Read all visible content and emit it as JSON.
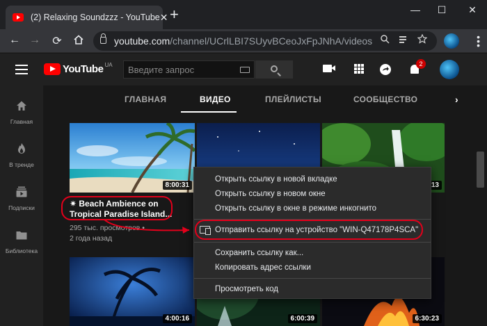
{
  "browser": {
    "tab_title": "(2) Relaxing Soundzzz - YouTube",
    "tab_close": "✕",
    "new_tab": "+",
    "url_host": "youtube.com",
    "url_path": "/channel/UCrlLBI7SUyvBCeoJxFpJNhA/videos",
    "window_minimize": "—",
    "window_maximize": "☐",
    "window_close": "✕",
    "back": "←",
    "forward": "→",
    "reload": "⟳"
  },
  "youtube": {
    "logo_text": "YouTube",
    "country_code": "UA",
    "search_placeholder": "Введите запрос",
    "notifications_count": "2"
  },
  "sidebar": {
    "items": [
      {
        "label": "Главная",
        "icon": "home-icon"
      },
      {
        "label": "В тренде",
        "icon": "trending-icon"
      },
      {
        "label": "Подписки",
        "icon": "subscriptions-icon"
      },
      {
        "label": "Библиотека",
        "icon": "library-icon"
      }
    ]
  },
  "channel_tabs": [
    {
      "label": "ГЛАВНАЯ"
    },
    {
      "label": "ВИДЕО"
    },
    {
      "label": "ПЛЕЙЛИСТЫ"
    },
    {
      "label": "СООБЩЕСТВО"
    }
  ],
  "videos": {
    "first": {
      "title": "✷ Beach Ambience on Tropical Paradise Island...",
      "views": "295 тыс. просмотров •",
      "age": "2 года назад",
      "duration": "8:00:31"
    },
    "durations": [
      "8:00:31",
      "13",
      "4:00:16",
      "6:00:39",
      "6:30:23"
    ]
  },
  "context_menu": {
    "items": [
      "Открыть ссылку в новой вкладке",
      "Открыть ссылку в новом окне",
      "Открыть ссылку в окне в режиме инкогнито",
      "Отправить ссылку на устройство \"WIN-Q47178P4SCA\"",
      "Сохранить ссылку как...",
      "Копировать адрес ссылки",
      "Просмотреть код"
    ]
  },
  "colors": {
    "accent_red": "#e3001b",
    "youtube_red": "#ff0000",
    "background": "#181818"
  }
}
